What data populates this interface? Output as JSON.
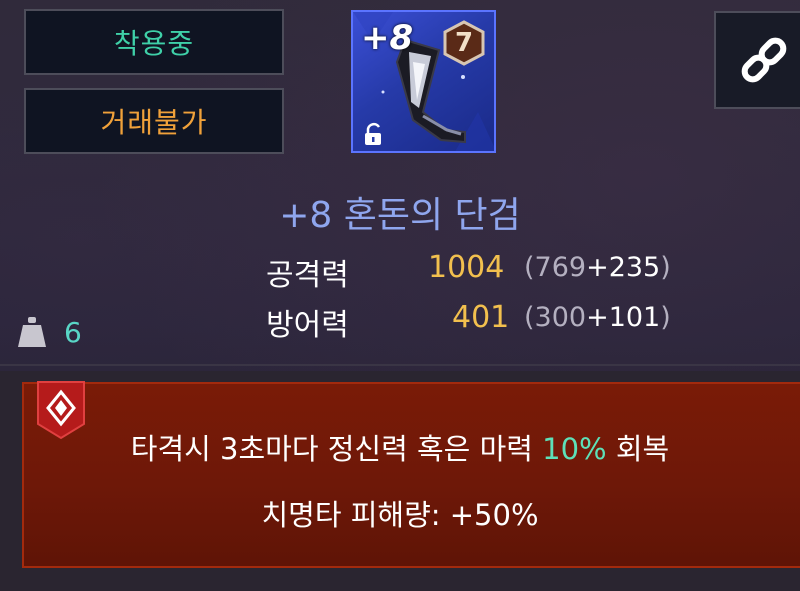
{
  "status_tags": {
    "equipped": "착용중",
    "untradable": "거래불가"
  },
  "item": {
    "enhancement_label": "+8",
    "tier": "7",
    "name": "+8 혼돈의 단검",
    "icon": "dagger-icon",
    "lock_icon": "unlock-icon"
  },
  "stats": {
    "attack": {
      "label": "공격력",
      "total": "1004",
      "base_open": "(769",
      "bonus": "+235",
      "close": ")"
    },
    "defense": {
      "label": "방어력",
      "total": "401",
      "base_open": "(300",
      "bonus": "+101",
      "close": ")"
    }
  },
  "weight": {
    "value": "6",
    "icon": "weight-icon"
  },
  "link_button": {
    "icon": "link-icon"
  },
  "effects": {
    "line1_prefix": "타격시 3초마다 정신력 혹은 마력 ",
    "line1_highlight": "10%",
    "line1_suffix": " 회복",
    "line2": "치명타 피해량: +50%"
  },
  "colors": {
    "equipped": "#3fd0a8",
    "untradable": "#f0a13a",
    "item_name": "#8fa6ee",
    "stat_total": "#f2c04e",
    "highlight": "#5de0b8",
    "effect_bg": "#6e1808"
  }
}
